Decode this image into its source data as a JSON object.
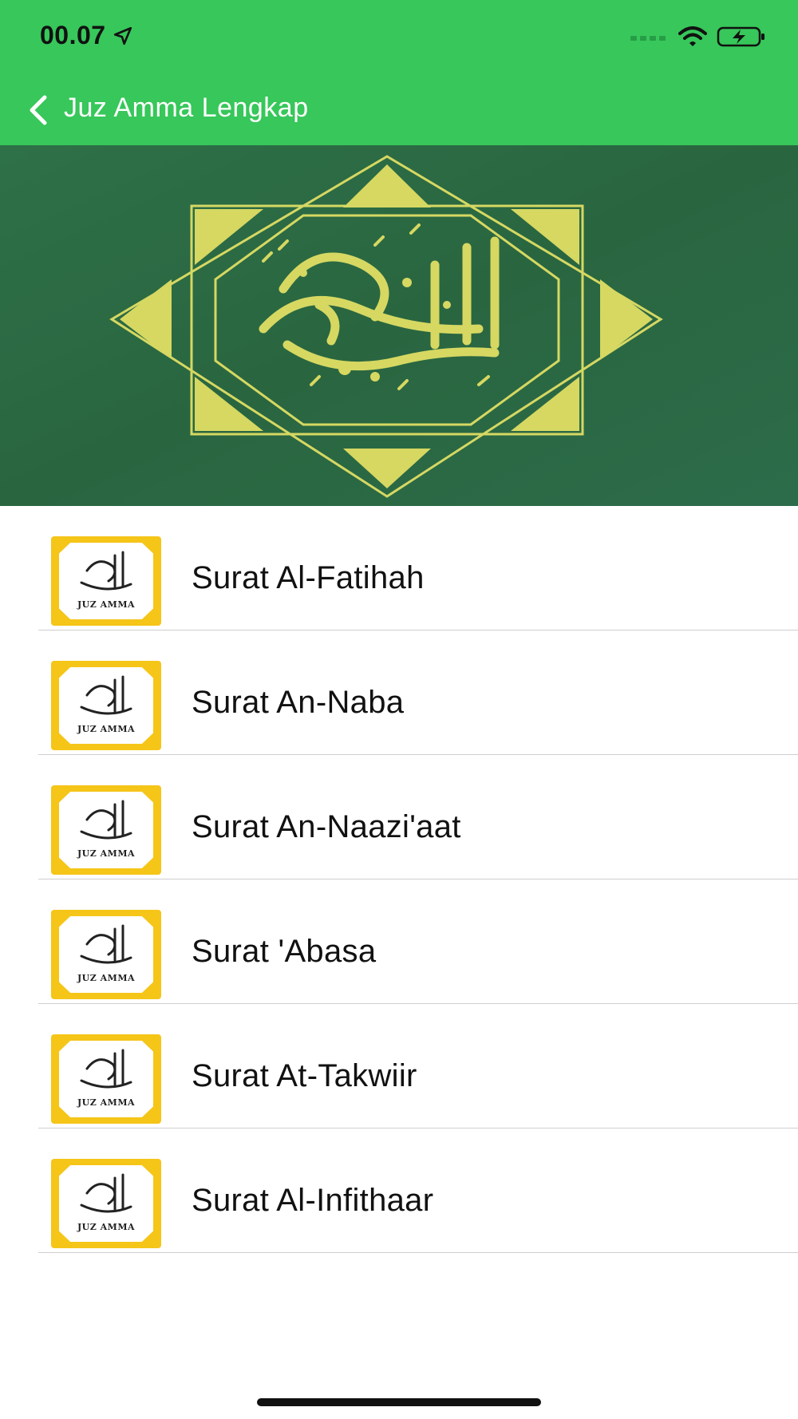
{
  "status_bar": {
    "time": "00.07",
    "icons": [
      "location-arrow-icon",
      "signal-icon",
      "wifi-icon",
      "battery-charging-icon"
    ]
  },
  "nav": {
    "title": "Juz Amma Lengkap",
    "back_icon": "chevron-left-icon"
  },
  "banner": {
    "image": "al-quran-al-karim-calligraphy"
  },
  "thumbnail_caption": "JUZ AMMA",
  "items": [
    {
      "label": "Surat Al-Fatihah"
    },
    {
      "label": "Surat An-Naba"
    },
    {
      "label": "Surat An-Naazi'aat"
    },
    {
      "label": "Surat 'Abasa"
    },
    {
      "label": "Surat At-Takwiir"
    },
    {
      "label": "Surat Al-Infithaar"
    }
  ],
  "colors": {
    "header": "#37c75a",
    "banner_bg": "#2b6a47",
    "ornament": "#d6d862",
    "thumb_border": "#f5c518"
  }
}
